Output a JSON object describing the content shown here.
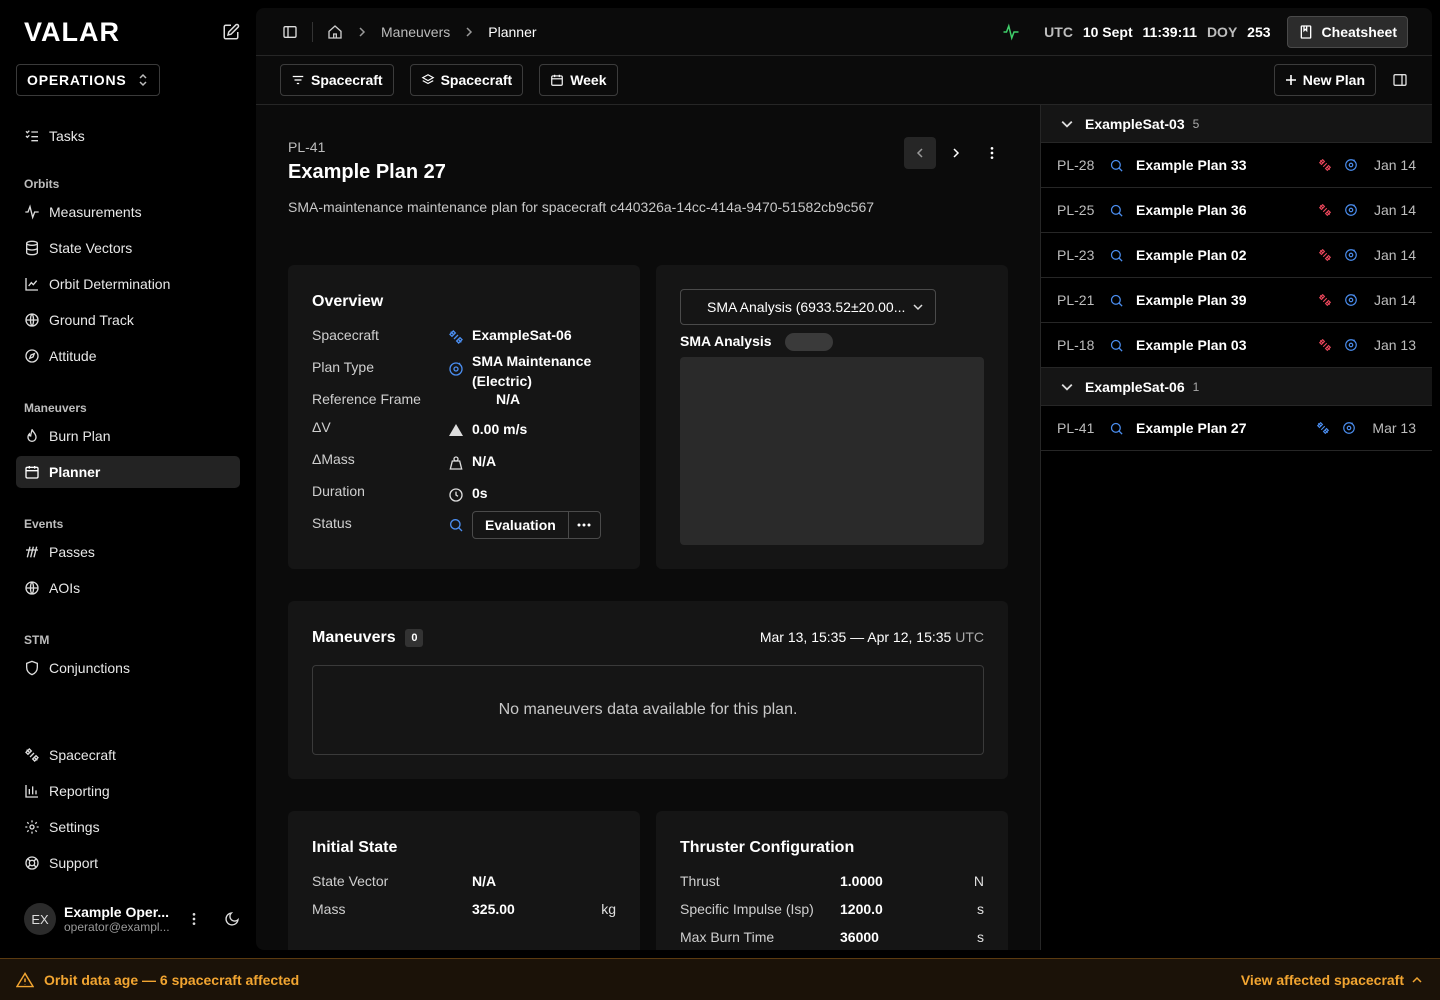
{
  "app": {
    "logo": "VALAR",
    "workspace": "OPERATIONS"
  },
  "sidebar": {
    "top_items": [
      {
        "label": "Tasks",
        "icon": "tasks-icon"
      }
    ],
    "sections": [
      {
        "title": "Orbits",
        "items": [
          {
            "label": "Measurements",
            "icon": "activity-icon"
          },
          {
            "label": "State Vectors",
            "icon": "database-icon"
          },
          {
            "label": "Orbit Determination",
            "icon": "chart-line-icon"
          },
          {
            "label": "Ground Track",
            "icon": "globe-icon"
          },
          {
            "label": "Attitude",
            "icon": "compass-icon"
          }
        ]
      },
      {
        "title": "Maneuvers",
        "items": [
          {
            "label": "Burn Plan",
            "icon": "flame-icon"
          },
          {
            "label": "Planner",
            "icon": "calendar-icon",
            "active": true
          }
        ]
      },
      {
        "title": "Events",
        "items": [
          {
            "label": "Passes",
            "icon": "passes-icon"
          },
          {
            "label": "AOIs",
            "icon": "globe-icon"
          }
        ]
      },
      {
        "title": "STM",
        "items": [
          {
            "label": "Conjunctions",
            "icon": "shield-icon"
          }
        ]
      }
    ],
    "bottom_items": [
      {
        "label": "Spacecraft",
        "icon": "satellite-icon"
      },
      {
        "label": "Reporting",
        "icon": "bar-chart-icon"
      },
      {
        "label": "Settings",
        "icon": "gear-icon"
      },
      {
        "label": "Support",
        "icon": "lifebuoy-icon"
      }
    ],
    "user": {
      "initials": "EX",
      "name": "Example Oper...",
      "email": "operator@exampl..."
    }
  },
  "header": {
    "breadcrumbs": [
      "Maneuvers",
      "Planner"
    ],
    "clock": {
      "tz": "UTC",
      "date": "10 Sept",
      "time": "11:39:11",
      "doy_label": "DOY",
      "doy": "253"
    },
    "cheatsheet": "Cheatsheet"
  },
  "toolbar": {
    "filters": [
      {
        "label": "Spacecraft",
        "icon": "filter-icon"
      },
      {
        "label": "Spacecraft",
        "icon": "layers-icon"
      },
      {
        "label": "Week",
        "icon": "calendar-icon"
      }
    ],
    "new_plan": "New Plan"
  },
  "plan": {
    "id": "PL-41",
    "title": "Example Plan 27",
    "description": "SMA-maintenance maintenance plan for spacecraft c440326a-14cc-414a-9470-51582cb9c567"
  },
  "overview": {
    "title": "Overview",
    "rows": [
      {
        "label": "Spacecraft",
        "value": "ExampleSat-06",
        "icon": "satellite-icon"
      },
      {
        "label": "Plan Type",
        "value": "SMA Maintenance (Electric)",
        "icon": "orbit-icon"
      },
      {
        "label": "Reference Frame",
        "value": "N/A"
      },
      {
        "label": "ΔV",
        "value": "0.00 m/s",
        "icon": "triangle-icon"
      },
      {
        "label": "ΔMass",
        "value": "N/A",
        "icon": "weight-icon"
      },
      {
        "label": "Duration",
        "value": "0s",
        "icon": "clock-icon"
      },
      {
        "label": "Status",
        "value": "Evaluation",
        "icon": "search-icon"
      }
    ]
  },
  "analysis": {
    "select": "SMA Analysis (6933.52±20.00...",
    "title": "SMA Analysis"
  },
  "maneuvers": {
    "title": "Maneuvers",
    "count": "0",
    "range": "Mar 13, 15:35 — Apr 12, 15:35",
    "tz": "UTC",
    "empty": "No maneuvers data available for this plan."
  },
  "initial_state": {
    "title": "Initial State",
    "rows": [
      {
        "label": "State Vector",
        "value": "N/A",
        "unit": ""
      },
      {
        "label": "Mass",
        "value": "325.00",
        "unit": "kg"
      }
    ]
  },
  "thruster": {
    "title": "Thruster Configuration",
    "rows": [
      {
        "label": "Thrust",
        "value": "1.0000",
        "unit": "N"
      },
      {
        "label": "Specific Impulse (Isp)",
        "value": "1200.0",
        "unit": "s"
      },
      {
        "label": "Max Burn Time",
        "value": "36000",
        "unit": "s"
      }
    ]
  },
  "plan_list": {
    "groups": [
      {
        "name": "ExampleSat-03",
        "count": "5",
        "items": [
          {
            "id": "PL-28",
            "name": "Example Plan 33",
            "date": "Jan 14",
            "sat_color": "#e8465a"
          },
          {
            "id": "PL-25",
            "name": "Example Plan 36",
            "date": "Jan 14",
            "sat_color": "#e8465a"
          },
          {
            "id": "PL-23",
            "name": "Example Plan 02",
            "date": "Jan 14",
            "sat_color": "#e8465a"
          },
          {
            "id": "PL-21",
            "name": "Example Plan 39",
            "date": "Jan 14",
            "sat_color": "#e8465a"
          },
          {
            "id": "PL-18",
            "name": "Example Plan 03",
            "date": "Jan 13",
            "sat_color": "#e8465a"
          }
        ]
      },
      {
        "name": "ExampleSat-06",
        "count": "1",
        "items": [
          {
            "id": "PL-41",
            "name": "Example Plan 27",
            "date": "Mar 13",
            "sat_color": "#4b8ef0"
          }
        ]
      }
    ]
  },
  "warning": {
    "text": "Orbit data age — 6 spacecraft affected",
    "action": "View affected spacecraft"
  },
  "colors": {
    "accent_blue": "#4b8ef0",
    "danger": "#e8465a",
    "warning": "#f2a531",
    "live_green": "#3fcf6a"
  }
}
